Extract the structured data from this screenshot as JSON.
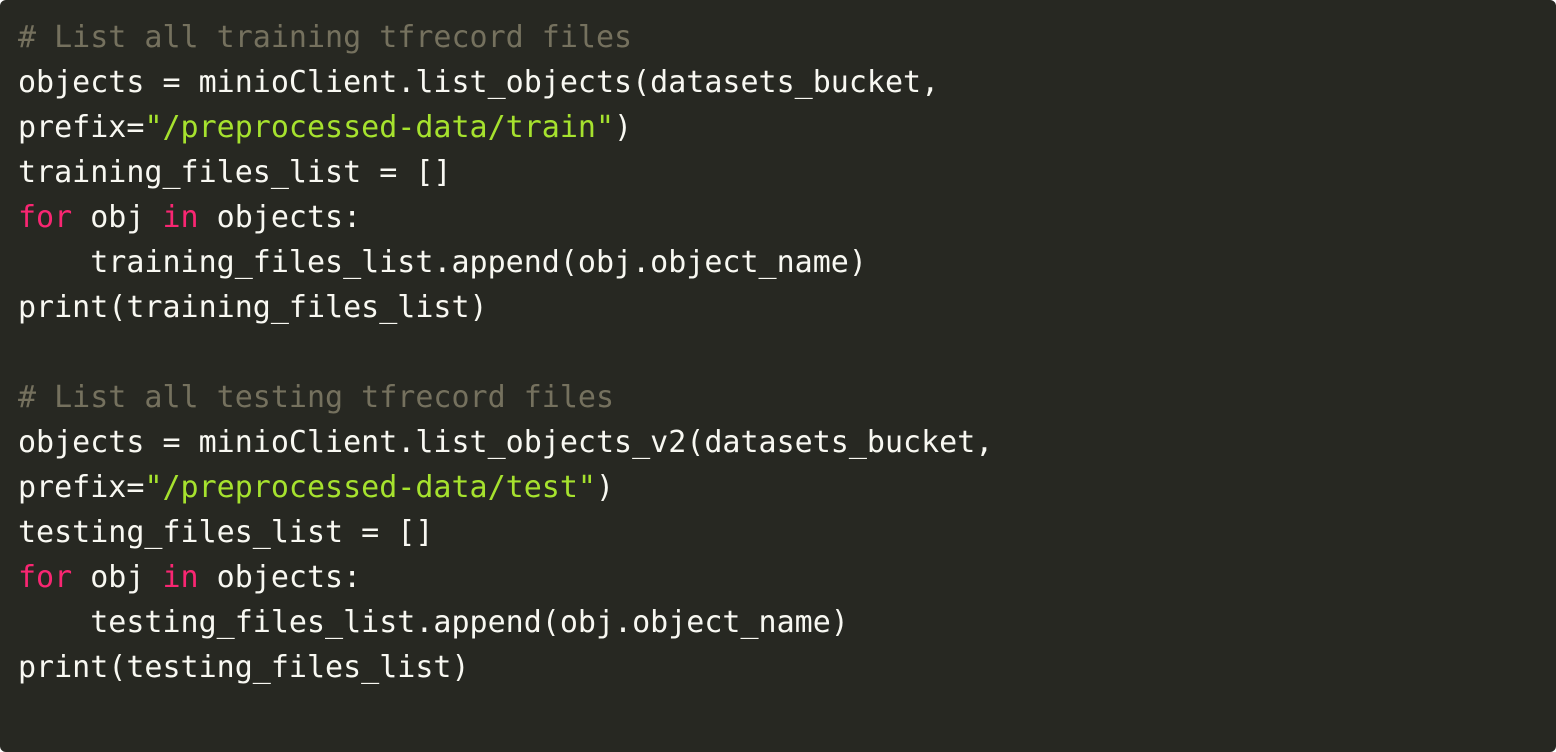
{
  "code_block": {
    "language": "python",
    "colors": {
      "background": "#272822",
      "plain": "#f8f8f2",
      "comment": "#75715e",
      "keyword": "#f92672",
      "string": "#a6e22e"
    },
    "lines": [
      [
        {
          "t": "comment",
          "v": "# List all training tfrecord files"
        }
      ],
      [
        {
          "t": "plain",
          "v": "objects = minioClient.list_objects(datasets_bucket,"
        }
      ],
      [
        {
          "t": "plain",
          "v": "prefix="
        },
        {
          "t": "string",
          "v": "\"/preprocessed-data/train\""
        },
        {
          "t": "plain",
          "v": ")"
        }
      ],
      [
        {
          "t": "plain",
          "v": "training_files_list = []"
        }
      ],
      [
        {
          "t": "keyword",
          "v": "for"
        },
        {
          "t": "plain",
          "v": " obj "
        },
        {
          "t": "keyword",
          "v": "in"
        },
        {
          "t": "plain",
          "v": " objects:"
        }
      ],
      [
        {
          "t": "plain",
          "v": "    training_files_list.append(obj.object_name)"
        }
      ],
      [
        {
          "t": "plain",
          "v": "print(training_files_list)"
        }
      ],
      [
        {
          "t": "plain",
          "v": ""
        }
      ],
      [
        {
          "t": "comment",
          "v": "# List all testing tfrecord files"
        }
      ],
      [
        {
          "t": "plain",
          "v": "objects = minioClient.list_objects_v2(datasets_bucket,"
        }
      ],
      [
        {
          "t": "plain",
          "v": "prefix="
        },
        {
          "t": "string",
          "v": "\"/preprocessed-data/test\""
        },
        {
          "t": "plain",
          "v": ")"
        }
      ],
      [
        {
          "t": "plain",
          "v": "testing_files_list = []"
        }
      ],
      [
        {
          "t": "keyword",
          "v": "for"
        },
        {
          "t": "plain",
          "v": " obj "
        },
        {
          "t": "keyword",
          "v": "in"
        },
        {
          "t": "plain",
          "v": " objects:"
        }
      ],
      [
        {
          "t": "plain",
          "v": "    testing_files_list.append(obj.object_name)"
        }
      ],
      [
        {
          "t": "plain",
          "v": "print(testing_files_list)"
        }
      ]
    ]
  }
}
